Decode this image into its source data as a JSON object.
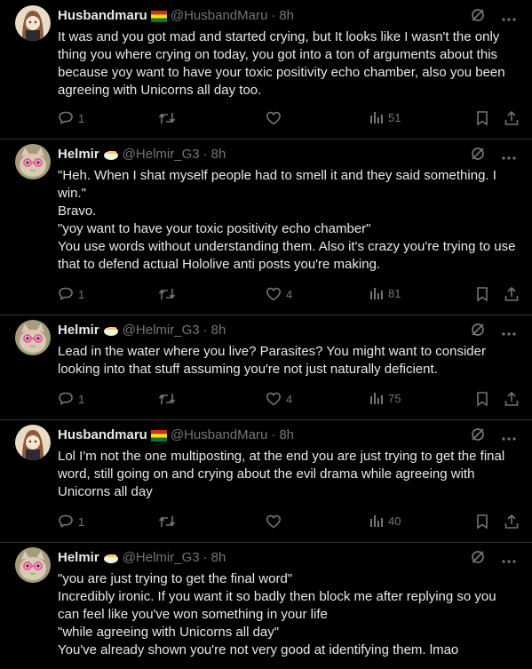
{
  "tweets": [
    {
      "name": "Husbandmaru",
      "flag": "bolivia",
      "handle": "@HusbandMaru",
      "sep": "·",
      "time": "8h",
      "avatar": "anime-girl",
      "lines": [
        "It was and you got mad and started crying, but It looks like I wasn't the only thing you where crying on today, you got into a ton of arguments about this because yoy want to have your toxic positivity echo chamber, also you been agreeing with Unicorns all day too."
      ],
      "replies": "1",
      "retweets": "",
      "likes": "",
      "views": "51"
    },
    {
      "name": "Helmir",
      "flag": "emoji",
      "handle": "@Helmir_G3",
      "sep": "·",
      "time": "8h",
      "avatar": "cat-glasses",
      "lines": [
        "\"Heh. When I shat myself people had to smell it and they said something. I win.\"",
        "Bravo.",
        "\"yoy want to have your toxic positivity echo chamber\"",
        "You use words without understanding them. Also it's crazy you're trying to use that to defend actual Hololive anti posts you're making."
      ],
      "replies": "1",
      "retweets": "",
      "likes": "4",
      "views": "81"
    },
    {
      "name": "Helmir",
      "flag": "emoji",
      "handle": "@Helmir_G3",
      "sep": "·",
      "time": "8h",
      "avatar": "cat-glasses",
      "lines": [
        "Lead in the water where you live? Parasites? You might want to consider looking into that stuff assuming you're not just naturally deficient."
      ],
      "replies": "1",
      "retweets": "",
      "likes": "4",
      "views": "75"
    },
    {
      "name": "Husbandmaru",
      "flag": "bolivia",
      "handle": "@HusbandMaru",
      "sep": "·",
      "time": "8h",
      "avatar": "anime-girl",
      "lines": [
        "Lol I'm not the one multiposting, at the end you are just trying to get the final word, still going on and crying about the evil drama while agreeing with Unicorns all day"
      ],
      "replies": "1",
      "retweets": "",
      "likes": "",
      "views": "40"
    },
    {
      "name": "Helmir",
      "flag": "emoji",
      "handle": "@Helmir_G3",
      "sep": "·",
      "time": "8h",
      "avatar": "cat-glasses",
      "lines": [
        "\"you are just trying to get the final word\"",
        "Incredibly ironic. If you want it so badly then block me after replying so you can feel like you've won something in your life",
        "\"while agreeing with Unicorns all day\"",
        "You've already shown you're not very good at identifying them. lmao"
      ],
      "replies": "",
      "retweets": "",
      "likes": "",
      "views": ""
    }
  ]
}
